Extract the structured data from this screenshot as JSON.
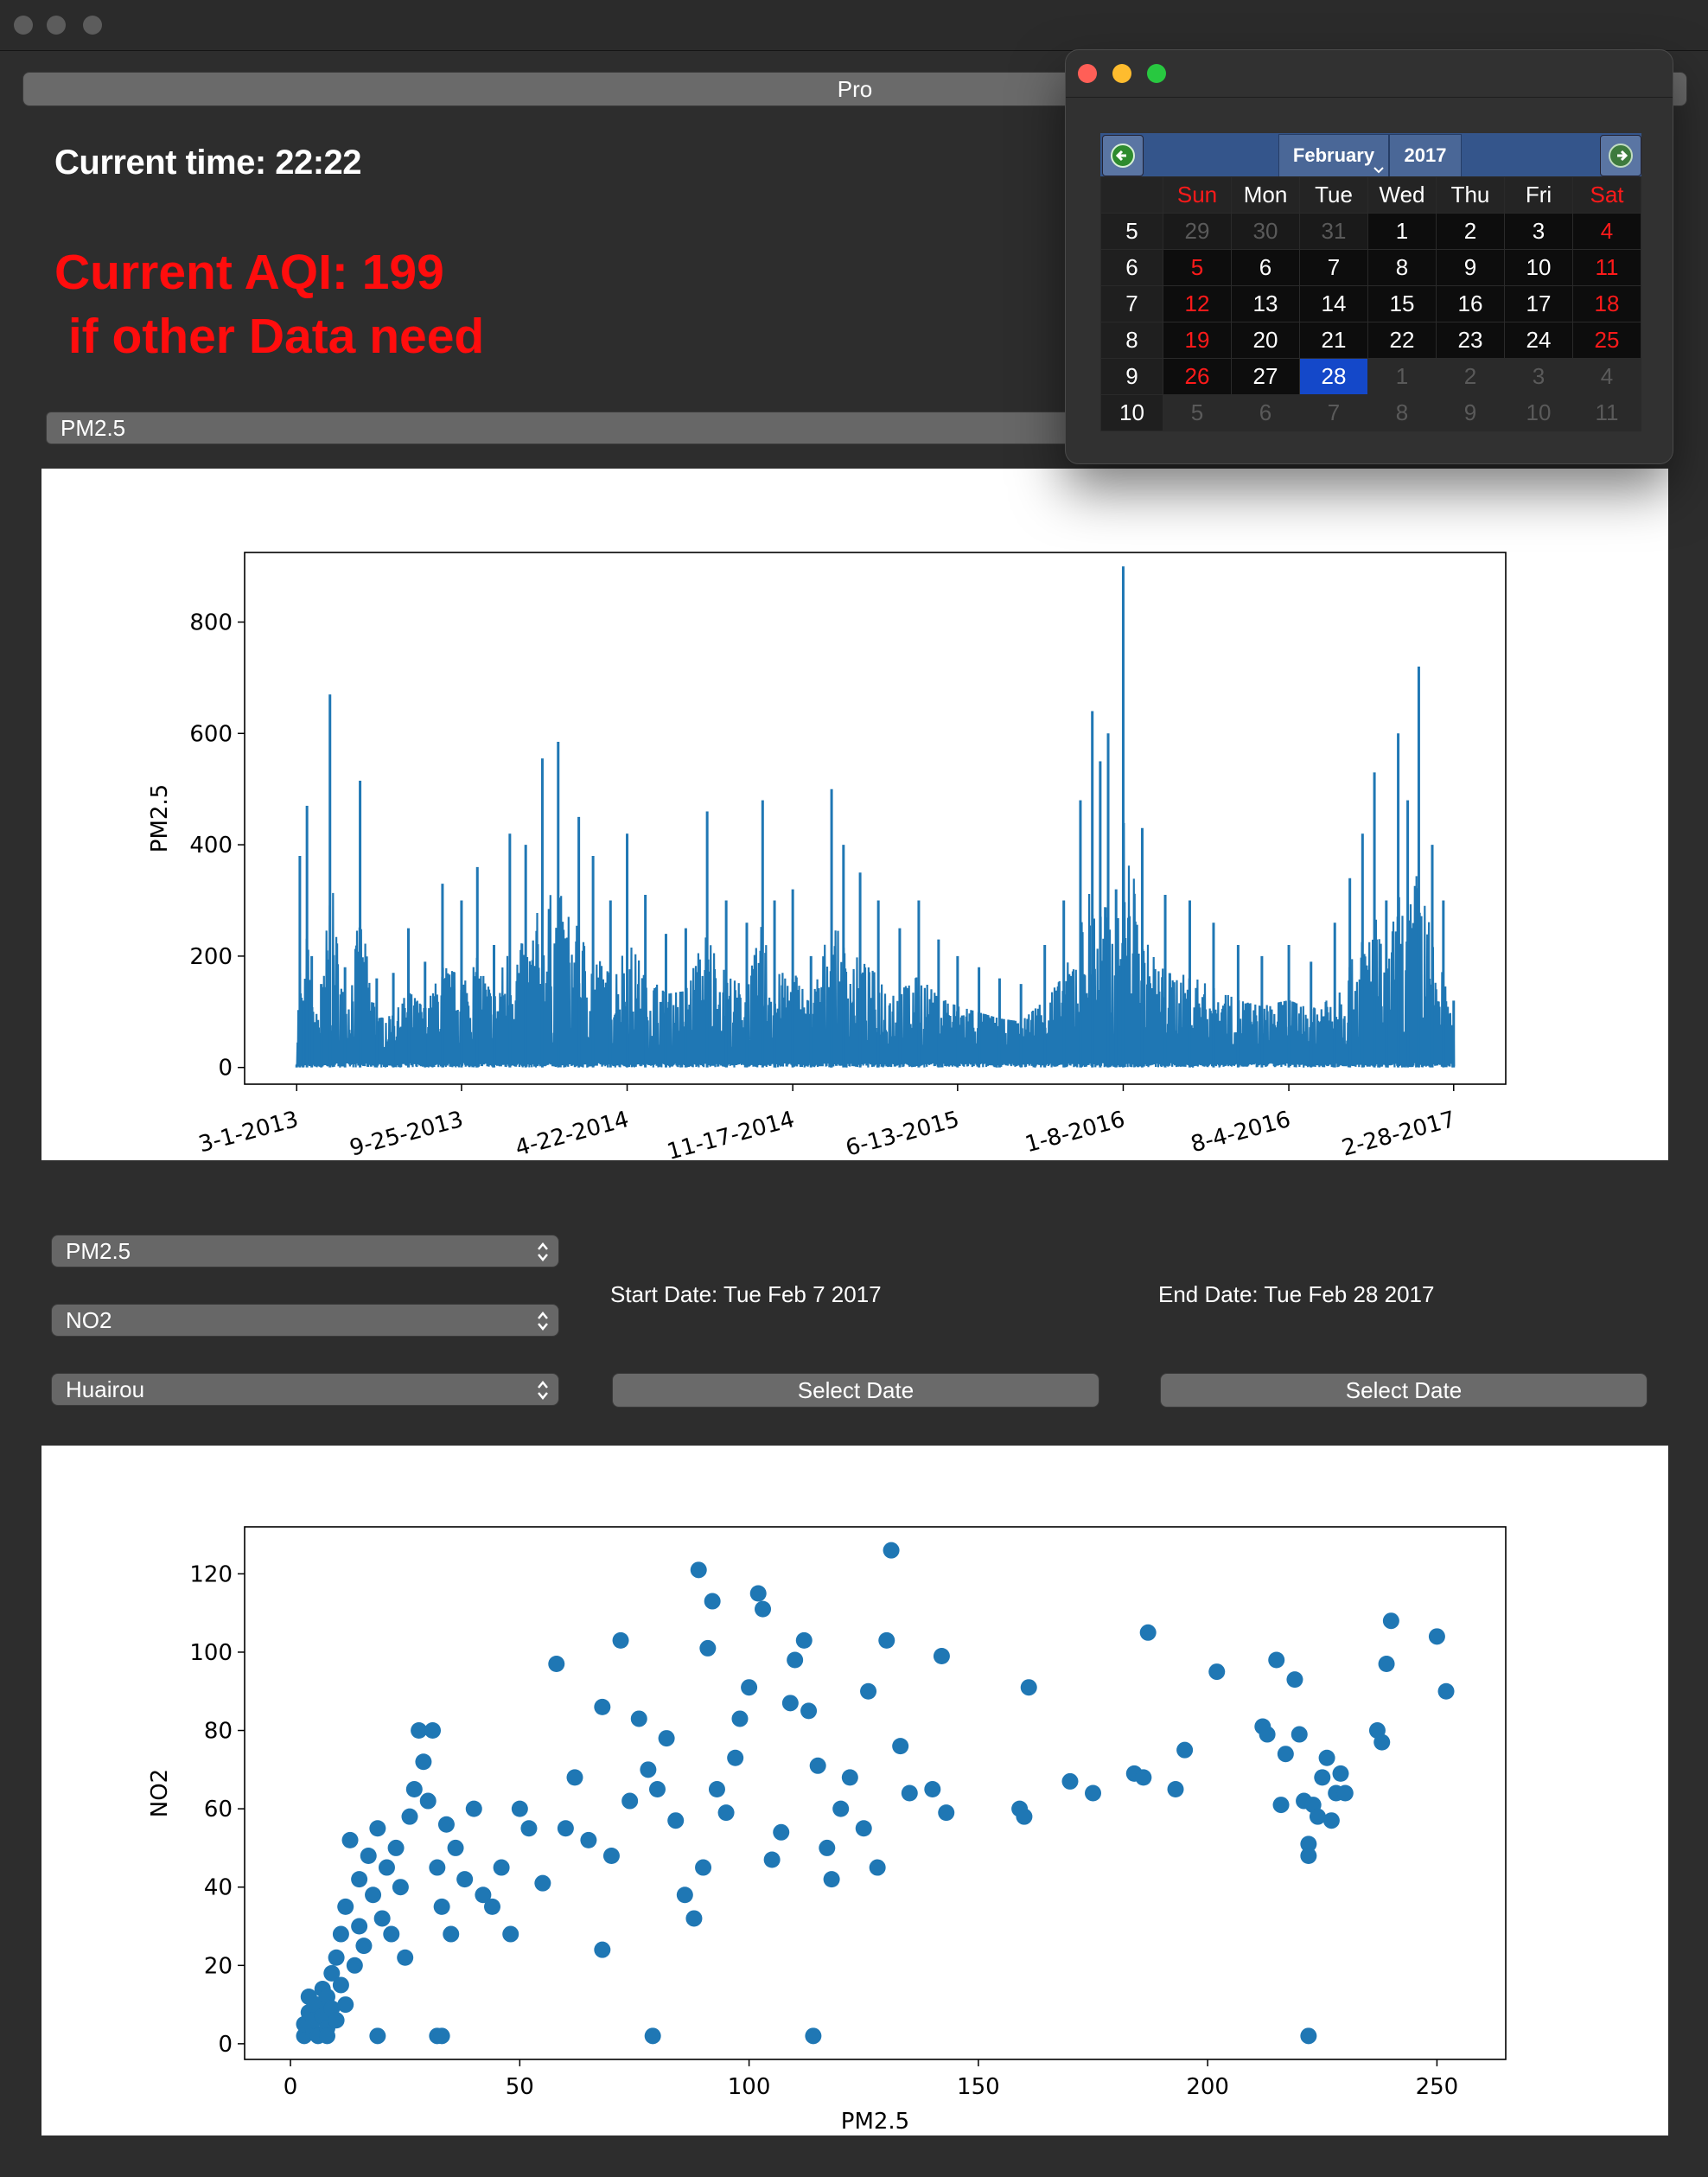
{
  "window": {
    "top_button_label": "Pro"
  },
  "header": {
    "current_time": "Current time: 22:22",
    "aqi_line1": "Current AQI: 199",
    "aqi_line2": " if other Data need"
  },
  "top_selector": {
    "value": "PM2.5"
  },
  "controls": {
    "pollutant_x": "PM2.5",
    "pollutant_y": "NO2",
    "station": "Huairou",
    "start_date_label": "Start Date: Tue Feb 7 2017",
    "end_date_label": "End Date: Tue Feb 28 2017",
    "select_date_start": "Select Date",
    "select_date_end": "Select Date"
  },
  "calendar": {
    "month": "February",
    "year": "2017",
    "weekdays": [
      "Sun",
      "Mon",
      "Tue",
      "Wed",
      "Thu",
      "Fri",
      "Sat"
    ],
    "weeks": [
      {
        "week": "5",
        "days": [
          "29",
          "30",
          "31",
          "1",
          "2",
          "3",
          "4"
        ]
      },
      {
        "week": "6",
        "days": [
          "5",
          "6",
          "7",
          "8",
          "9",
          "10",
          "11"
        ]
      },
      {
        "week": "7",
        "days": [
          "12",
          "13",
          "14",
          "15",
          "16",
          "17",
          "18"
        ]
      },
      {
        "week": "8",
        "days": [
          "19",
          "20",
          "21",
          "22",
          "23",
          "24",
          "25"
        ]
      },
      {
        "week": "9",
        "days": [
          "26",
          "27",
          "28",
          "1",
          "2",
          "3",
          "4"
        ]
      },
      {
        "week": "10",
        "days": [
          "5",
          "6",
          "7",
          "8",
          "9",
          "10",
          "11"
        ]
      }
    ],
    "selected_day": "28",
    "colors": {
      "header": "#34558b",
      "selected": "#1448c9",
      "weekend": "#ff1a1a",
      "nav_arrow": "#2e8b2e"
    }
  },
  "chart_data": [
    {
      "type": "line",
      "title": "",
      "xlabel": "",
      "ylabel": "PM2.5",
      "x_ticks": [
        "3-1-2013",
        "9-25-2013",
        "4-22-2014",
        "11-17-2014",
        "6-13-2015",
        "1-8-2016",
        "8-4-2016",
        "2-28-2017"
      ],
      "y_ticks": [
        0,
        200,
        400,
        600,
        800
      ],
      "ylim": [
        -30,
        925
      ],
      "color": "#1f77b4",
      "series": [
        {
          "x": [
            "2013-03-01",
            "2013-03-05",
            "2013-03-09",
            "2013-03-14",
            "2013-03-20",
            "2013-04-01",
            "2013-04-12",
            "2013-05-01",
            "2013-05-20",
            "2013-06-10",
            "2013-07-01",
            "2013-07-20",
            "2013-08-10",
            "2013-09-01",
            "2013-09-25",
            "2013-10-15",
            "2013-11-05",
            "2013-11-25",
            "2013-12-15",
            "2014-01-05",
            "2014-01-25",
            "2014-02-20",
            "2014-03-10",
            "2014-04-01",
            "2014-04-22",
            "2014-05-15",
            "2014-06-10",
            "2014-07-05",
            "2014-08-01",
            "2014-08-25",
            "2014-09-20",
            "2014-10-10",
            "2014-10-25",
            "2014-11-17",
            "2014-12-10",
            "2015-01-05",
            "2015-01-20",
            "2015-02-10",
            "2015-03-05",
            "2015-04-01",
            "2015-04-25",
            "2015-05-20",
            "2015-06-13",
            "2015-07-10",
            "2015-08-05",
            "2015-09-01",
            "2015-10-01",
            "2015-10-25",
            "2015-11-15",
            "2015-11-30",
            "2015-12-10",
            "2015-12-20",
            "2015-12-30",
            "2016-01-08",
            "2016-02-01",
            "2016-03-01",
            "2016-04-01",
            "2016-05-01",
            "2016-06-01",
            "2016-07-01",
            "2016-08-04",
            "2016-09-01",
            "2016-10-01",
            "2016-10-20",
            "2016-11-05",
            "2016-11-20",
            "2016-12-05",
            "2016-12-20",
            "2017-01-01",
            "2017-01-15",
            "2017-02-01",
            "2017-02-15",
            "2017-02-28"
          ],
          "y": [
            5,
            380,
            120,
            470,
            200,
            150,
            670,
            180,
            515,
            160,
            170,
            250,
            190,
            330,
            300,
            360,
            220,
            420,
            400,
            555,
            585,
            450,
            380,
            300,
            420,
            310,
            240,
            250,
            460,
            300,
            260,
            480,
            300,
            320,
            200,
            500,
            400,
            350,
            300,
            250,
            300,
            230,
            200,
            180,
            160,
            150,
            220,
            300,
            480,
            640,
            550,
            600,
            320,
            900,
            430,
            310,
            300,
            260,
            220,
            200,
            220,
            190,
            260,
            340,
            420,
            530,
            300,
            600,
            480,
            720,
            400,
            300,
            120
          ]
        }
      ]
    },
    {
      "type": "scatter",
      "title": "",
      "xlabel": "PM2.5",
      "ylabel": "NO2",
      "x_ticks": [
        0,
        50,
        100,
        150,
        200,
        250
      ],
      "y_ticks": [
        0,
        20,
        40,
        60,
        80,
        100,
        120
      ],
      "xlim": [
        -10,
        265
      ],
      "ylim": [
        -4,
        132
      ],
      "color": "#1f77b4",
      "series": [
        {
          "points": [
            [
              3,
              2
            ],
            [
              3,
              5
            ],
            [
              4,
              8
            ],
            [
              4,
              12
            ],
            [
              5,
              3
            ],
            [
              5,
              6
            ],
            [
              6,
              10
            ],
            [
              6,
              2
            ],
            [
              7,
              14
            ],
            [
              7,
              7
            ],
            [
              8,
              4
            ],
            [
              8,
              12
            ],
            [
              9,
              18
            ],
            [
              9,
              9
            ],
            [
              10,
              22
            ],
            [
              10,
              6
            ],
            [
              11,
              28
            ],
            [
              11,
              15
            ],
            [
              12,
              35
            ],
            [
              12,
              10
            ],
            [
              13,
              52
            ],
            [
              14,
              20
            ],
            [
              15,
              42
            ],
            [
              15,
              30
            ],
            [
              16,
              25
            ],
            [
              17,
              48
            ],
            [
              18,
              38
            ],
            [
              19,
              55
            ],
            [
              20,
              32
            ],
            [
              21,
              45
            ],
            [
              22,
              28
            ],
            [
              23,
              50
            ],
            [
              24,
              40
            ],
            [
              25,
              22
            ],
            [
              26,
              58
            ],
            [
              27,
              65
            ],
            [
              28,
              80
            ],
            [
              29,
              72
            ],
            [
              30,
              62
            ],
            [
              31,
              80
            ],
            [
              32,
              45
            ],
            [
              33,
              35
            ],
            [
              34,
              56
            ],
            [
              35,
              28
            ],
            [
              36,
              50
            ],
            [
              38,
              42
            ],
            [
              40,
              60
            ],
            [
              42,
              38
            ],
            [
              44,
              35
            ],
            [
              46,
              45
            ],
            [
              48,
              28
            ],
            [
              50,
              60
            ],
            [
              52,
              55
            ],
            [
              55,
              41
            ],
            [
              58,
              97
            ],
            [
              60,
              55
            ],
            [
              62,
              68
            ],
            [
              65,
              52
            ],
            [
              68,
              86
            ],
            [
              70,
              48
            ],
            [
              72,
              103
            ],
            [
              74,
              62
            ],
            [
              76,
              83
            ],
            [
              78,
              70
            ],
            [
              80,
              65
            ],
            [
              82,
              78
            ],
            [
              84,
              57
            ],
            [
              86,
              38
            ],
            [
              88,
              32
            ],
            [
              89,
              121
            ],
            [
              90,
              45
            ],
            [
              91,
              101
            ],
            [
              92,
              113
            ],
            [
              93,
              65
            ],
            [
              95,
              59
            ],
            [
              97,
              73
            ],
            [
              98,
              83
            ],
            [
              100,
              91
            ],
            [
              102,
              115
            ],
            [
              103,
              111
            ],
            [
              105,
              47
            ],
            [
              107,
              54
            ],
            [
              109,
              87
            ],
            [
              110,
              98
            ],
            [
              112,
              103
            ],
            [
              113,
              85
            ],
            [
              115,
              71
            ],
            [
              117,
              50
            ],
            [
              118,
              42
            ],
            [
              120,
              60
            ],
            [
              122,
              68
            ],
            [
              125,
              55
            ],
            [
              126,
              90
            ],
            [
              128,
              45
            ],
            [
              130,
              103
            ],
            [
              131,
              126
            ],
            [
              133,
              76
            ],
            [
              135,
              64
            ],
            [
              140,
              65
            ],
            [
              142,
              99
            ],
            [
              143,
              59
            ],
            [
              159,
              60
            ],
            [
              160,
              58
            ],
            [
              161,
              91
            ],
            [
              170,
              67
            ],
            [
              175,
              64
            ],
            [
              184,
              69
            ],
            [
              186,
              68
            ],
            [
              187,
              105
            ],
            [
              193,
              65
            ],
            [
              195,
              75
            ],
            [
              202,
              95
            ],
            [
              212,
              81
            ],
            [
              213,
              79
            ],
            [
              215,
              98
            ],
            [
              216,
              61
            ],
            [
              217,
              74
            ],
            [
              219,
              93
            ],
            [
              220,
              79
            ],
            [
              221,
              62
            ],
            [
              222,
              51
            ],
            [
              222,
              48
            ],
            [
              223,
              61
            ],
            [
              224,
              58
            ],
            [
              225,
              68
            ],
            [
              226,
              73
            ],
            [
              227,
              57
            ],
            [
              228,
              64
            ],
            [
              229,
              69
            ],
            [
              230,
              64
            ],
            [
              237,
              80
            ],
            [
              238,
              77
            ],
            [
              239,
              97
            ],
            [
              240,
              108
            ],
            [
              250,
              104
            ],
            [
              252,
              90
            ],
            [
              8,
              2
            ],
            [
              19,
              2
            ],
            [
              32,
              2
            ],
            [
              33,
              2
            ],
            [
              79,
              2
            ],
            [
              114,
              2
            ],
            [
              222,
              2
            ],
            [
              68,
              24
            ]
          ]
        }
      ]
    }
  ]
}
